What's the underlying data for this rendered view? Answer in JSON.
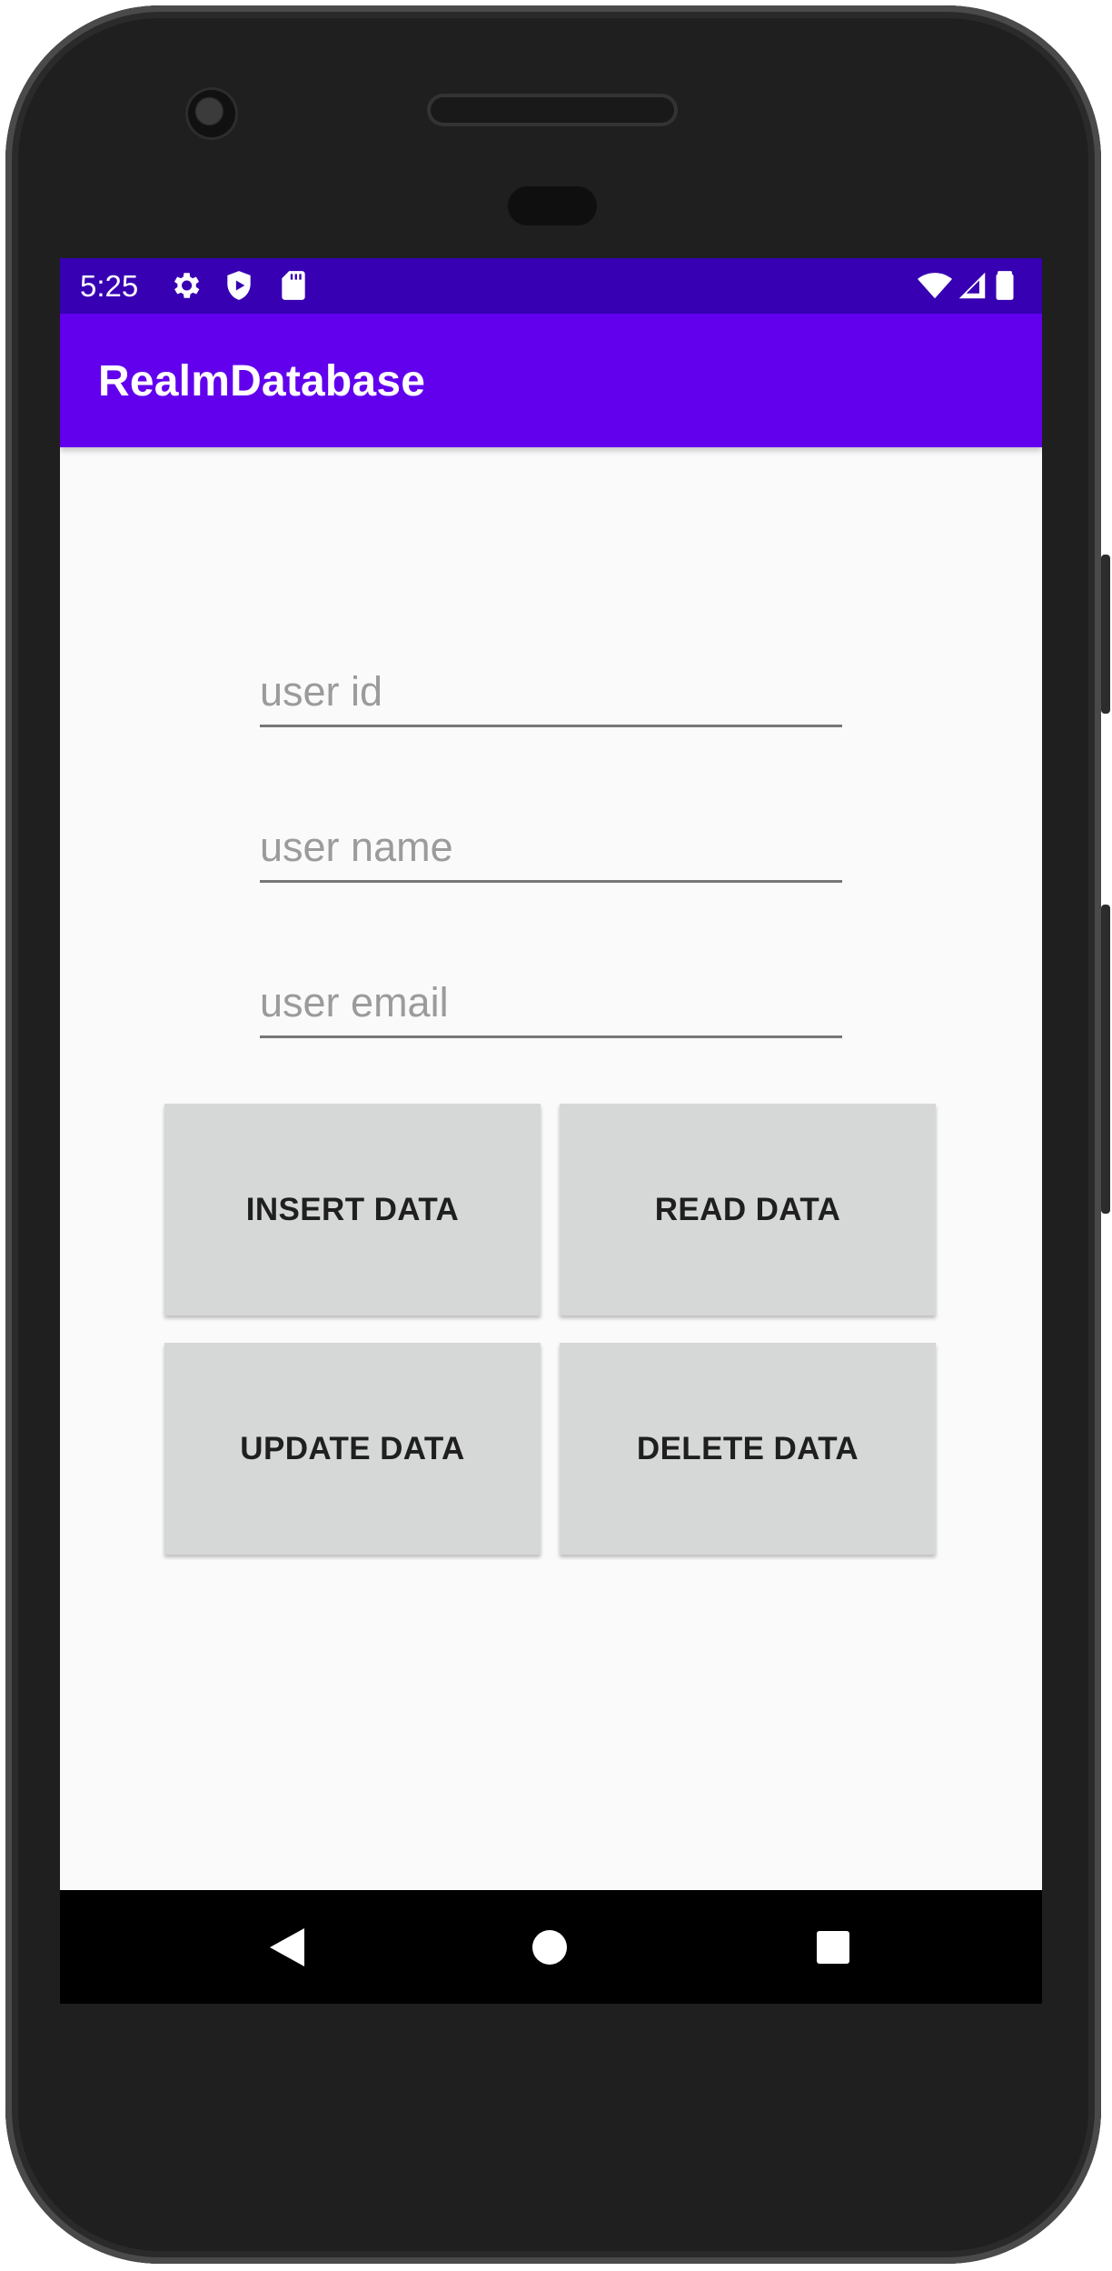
{
  "status_bar": {
    "time": "5:25",
    "left_icons": [
      "gear-icon",
      "shield-icon",
      "sd-card-icon"
    ],
    "right_icons": [
      "wifi-icon",
      "signal-icon",
      "battery-icon"
    ]
  },
  "app_bar": {
    "title": "RealmDatabase",
    "color": "#6200ee",
    "status_color": "#3700b3"
  },
  "form": {
    "user_id": {
      "value": "",
      "placeholder": "user id"
    },
    "user_name": {
      "value": "",
      "placeholder": "user name"
    },
    "user_email": {
      "value": "",
      "placeholder": "user email"
    }
  },
  "buttons": {
    "insert": "INSERT DATA",
    "read": "READ DATA",
    "update": "UPDATE DATA",
    "delete": "DELETE DATA"
  },
  "nav_bar": {
    "icons": [
      "back-icon",
      "home-icon",
      "recents-icon"
    ]
  }
}
